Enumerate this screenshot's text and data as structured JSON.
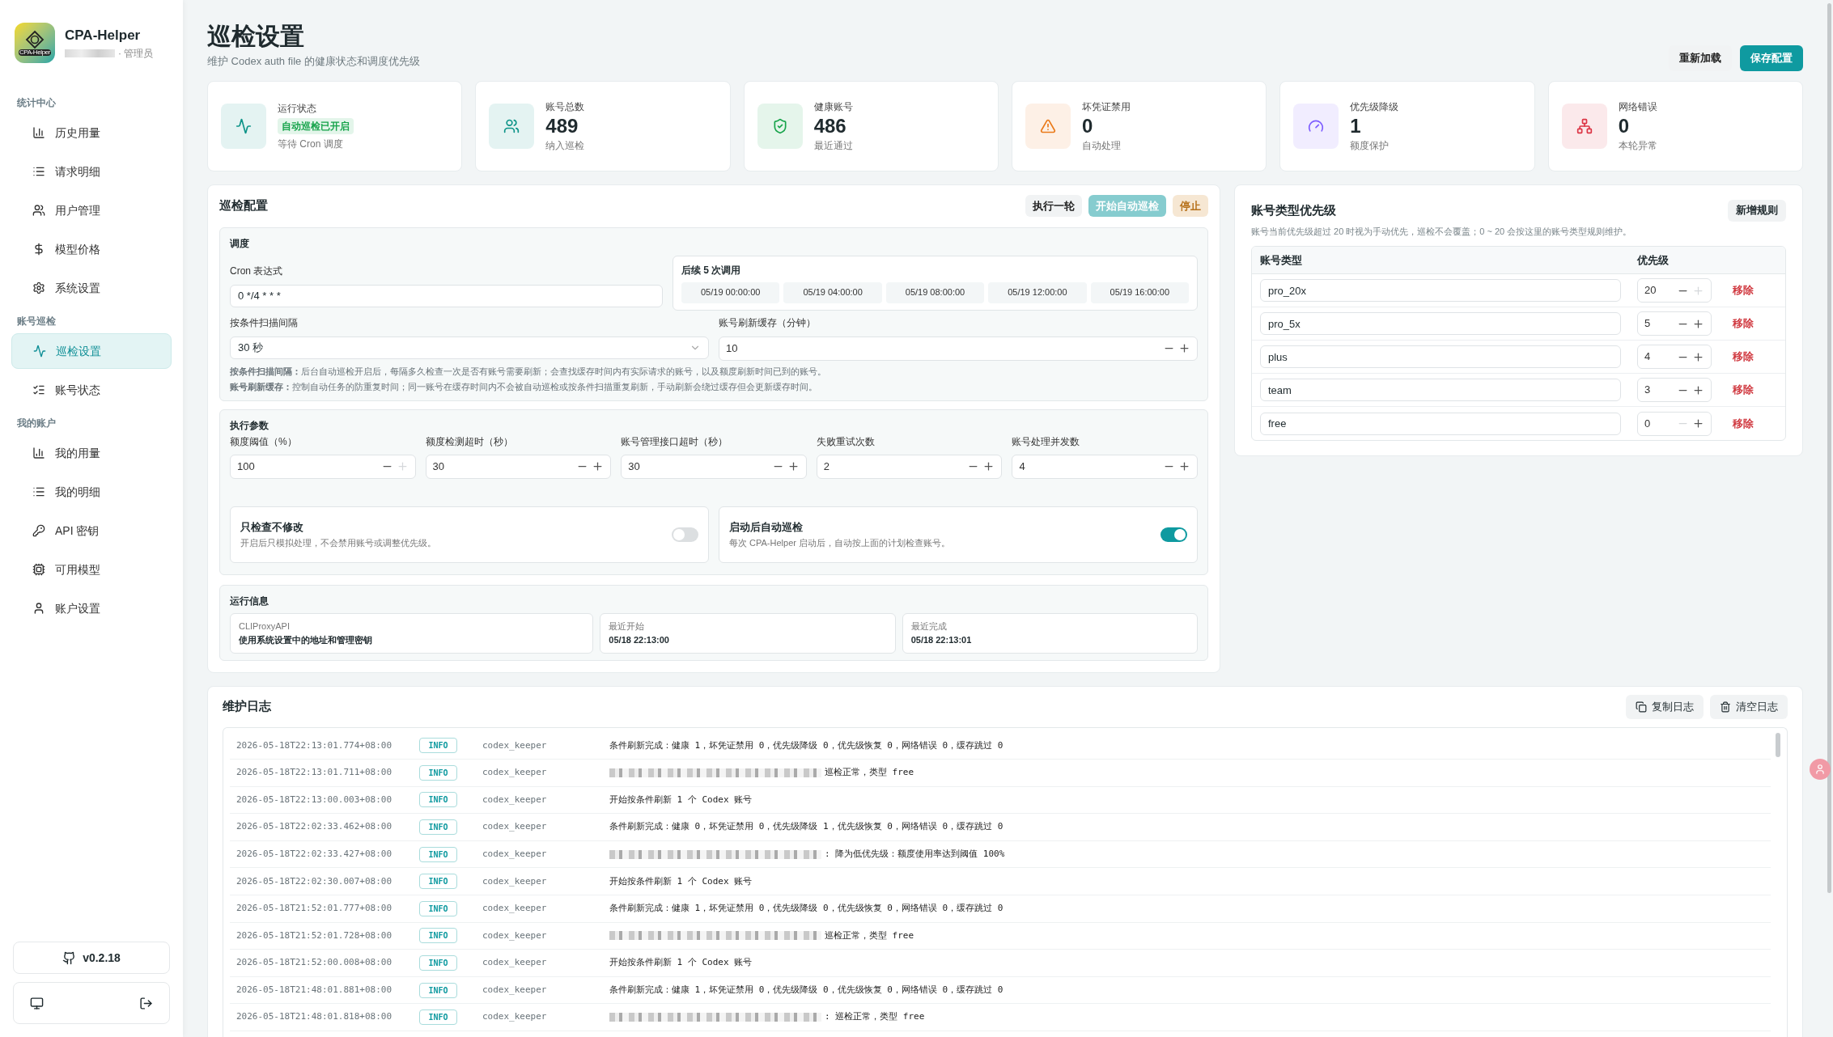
{
  "sidebar": {
    "app_name": "CPA-Helper",
    "logo_text": "CPA-Helper",
    "user_role": "· 管理员",
    "sections": [
      {
        "title": "统计中心",
        "items": [
          {
            "label": "历史用量",
            "selected": false
          },
          {
            "label": "请求明细",
            "selected": false
          },
          {
            "label": "用户管理",
            "selected": false
          },
          {
            "label": "模型价格",
            "selected": false
          },
          {
            "label": "系统设置",
            "selected": false
          }
        ]
      },
      {
        "title": "账号巡检",
        "items": [
          {
            "label": "巡检设置",
            "selected": true
          },
          {
            "label": "账号状态",
            "selected": false
          }
        ]
      },
      {
        "title": "我的账户",
        "items": [
          {
            "label": "我的用量",
            "selected": false
          },
          {
            "label": "我的明细",
            "selected": false
          },
          {
            "label": "API 密钥",
            "selected": false
          },
          {
            "label": "可用模型",
            "selected": false
          },
          {
            "label": "账户设置",
            "selected": false
          }
        ]
      }
    ],
    "version": "v0.2.18"
  },
  "header": {
    "title": "巡检设置",
    "subtitle": "维护 Codex auth file 的健康状态和调度优先级",
    "buttons": [
      {
        "label": "重新加载",
        "kind": "neutral"
      },
      {
        "label": "保存配置",
        "kind": "primary"
      }
    ]
  },
  "stats": [
    {
      "label": "运行状态",
      "badge": "自动巡检已开启",
      "note": "等待 Cron 调度",
      "color": "#0d9488"
    },
    {
      "label": "账号总数",
      "value": "489",
      "note": "纳入巡检",
      "color": "#0d9488"
    },
    {
      "label": "健康账号",
      "value": "486",
      "note": "最近通过",
      "color": "#16a34a"
    },
    {
      "label": "坏凭证禁用",
      "value": "0",
      "note": "自动处理",
      "color": "#ea7a1a"
    },
    {
      "label": "优先级降级",
      "value": "1",
      "note": "额度保护",
      "color": "#7c5cff"
    },
    {
      "label": "网络错误",
      "value": "0",
      "note": "本轮异常",
      "color": "#dc3545"
    }
  ],
  "config": {
    "title": "巡检配置",
    "buttons": [
      {
        "label": "执行一轮",
        "kind": "neutral",
        "disabled": false
      },
      {
        "label": "开始自动巡检",
        "kind": "primary",
        "disabled": true
      },
      {
        "label": "停止",
        "kind": "warning",
        "disabled": false
      }
    ],
    "schedule": {
      "title": "调度",
      "cron_label": "Cron 表达式",
      "cron_value": "0 */4 * * *",
      "next_title": "后续 5 次调用",
      "next_runs": [
        "05/19 00:00:00",
        "05/19 04:00:00",
        "05/19 08:00:00",
        "05/19 12:00:00",
        "05/19 16:00:00"
      ],
      "interval_label": "按条件扫描间隔",
      "interval_value": "30 秒",
      "cache_label": "账号刷新缓存（分钟）",
      "cache_value": "10",
      "notes": [
        "**按条件扫描间隔：**后台自动巡检开启后，每隔多久检查一次是否有账号需要刷新；会查找缓存时间内有实际请求的账号，以及额度刷新时间已到的账号。",
        "**账号刷新缓存：**控制自动任务的防重复时间；同一账号在缓存时间内不会被自动巡检或按条件扫描重复刷新，手动刷新会绕过缓存但会更新缓存时间。"
      ]
    },
    "params": {
      "title": "执行参数",
      "fields": [
        {
          "label": "额度阈值（%）",
          "value": "100",
          "minus_disabled": false,
          "plus_disabled": true
        },
        {
          "label": "额度检测超时（秒）",
          "value": "30",
          "minus_disabled": false,
          "plus_disabled": false
        },
        {
          "label": "账号管理接口超时（秒）",
          "value": "30",
          "minus_disabled": false,
          "plus_disabled": false
        },
        {
          "label": "失败重试次数",
          "value": "2",
          "minus_disabled": false,
          "plus_disabled": false
        },
        {
          "label": "账号处理并发数",
          "value": "4",
          "minus_disabled": false,
          "plus_disabled": false
        }
      ],
      "toggles": [
        {
          "title": "只检查不修改",
          "description": "开启后只模拟处理，不会禁用账号或调整优先级。",
          "on": false
        },
        {
          "title": "启动后自动巡检",
          "description": "每次 CPA-Helper 启动后，自动按上面的计划检查账号。",
          "on": true
        }
      ]
    },
    "runtime": {
      "title": "运行信息",
      "items": [
        {
          "label": "CLIProxyAPI",
          "value": "使用系统设置中的地址和管理密钥"
        },
        {
          "label": "最近开始",
          "value": "05/18 22:13:00"
        },
        {
          "label": "最近完成",
          "value": "05/18 22:13:01"
        }
      ]
    }
  },
  "priority": {
    "title": "账号类型优先级",
    "action": "新增规则",
    "description": "账号当前优先级超过 20 时视为手动优先，巡检不会覆盖；0 ~ 20 会按这里的账号类型规则维护。",
    "columns": [
      "账号类型",
      "优先级"
    ],
    "rows": [
      {
        "type": "pro_20x",
        "priority": "20",
        "minus_disabled": false,
        "plus_disabled": true,
        "remove": "移除"
      },
      {
        "type": "pro_5x",
        "priority": "5",
        "minus_disabled": false,
        "plus_disabled": false,
        "remove": "移除"
      },
      {
        "type": "plus",
        "priority": "4",
        "minus_disabled": false,
        "plus_disabled": false,
        "remove": "移除"
      },
      {
        "type": "team",
        "priority": "3",
        "minus_disabled": false,
        "plus_disabled": false,
        "remove": "移除"
      },
      {
        "type": "free",
        "priority": "0",
        "minus_disabled": true,
        "plus_disabled": false,
        "remove": "移除"
      }
    ]
  },
  "log": {
    "title": "维护日志",
    "buttons": [
      "复制日志",
      "清空日志"
    ],
    "entries": [
      {
        "time": "2026-05-18T22:13:01.774+08:00",
        "level": "INFO",
        "source": "codex_keeper",
        "message": "条件刷新完成：健康 1，坏凭证禁用 0，优先级降级 0，优先级恢复 0，网络错误 0，缓存跳过 0",
        "redacted": false
      },
      {
        "time": "2026-05-18T22:13:01.711+08:00",
        "level": "INFO",
        "source": "codex_keeper",
        "message": "巡检正常，类型 free",
        "redacted": true
      },
      {
        "time": "2026-05-18T22:13:00.003+08:00",
        "level": "INFO",
        "source": "codex_keeper",
        "message": "开始按条件刷新 1 个 Codex 账号",
        "redacted": false
      },
      {
        "time": "2026-05-18T22:02:33.462+08:00",
        "level": "INFO",
        "source": "codex_keeper",
        "message": "条件刷新完成：健康 0，坏凭证禁用 0，优先级降级 1，优先级恢复 0，网络错误 0，缓存跳过 0",
        "redacted": false
      },
      {
        "time": "2026-05-18T22:02:33.427+08:00",
        "level": "INFO",
        "source": "codex_keeper",
        "message": ": 降为低优先级：额度使用率达到阈值 100%",
        "redacted": true
      },
      {
        "time": "2026-05-18T22:02:30.007+08:00",
        "level": "INFO",
        "source": "codex_keeper",
        "message": "开始按条件刷新 1 个 Codex 账号",
        "redacted": false
      },
      {
        "time": "2026-05-18T21:52:01.777+08:00",
        "level": "INFO",
        "source": "codex_keeper",
        "message": "条件刷新完成：健康 1，坏凭证禁用 0，优先级降级 0，优先级恢复 0，网络错误 0，缓存跳过 0",
        "redacted": false
      },
      {
        "time": "2026-05-18T21:52:01.728+08:00",
        "level": "INFO",
        "source": "codex_keeper",
        "message": "巡检正常，类型 free",
        "redacted": true
      },
      {
        "time": "2026-05-18T21:52:00.008+08:00",
        "level": "INFO",
        "source": "codex_keeper",
        "message": "开始按条件刷新 1 个 Codex 账号",
        "redacted": false
      },
      {
        "time": "2026-05-18T21:48:01.881+08:00",
        "level": "INFO",
        "source": "codex_keeper",
        "message": "条件刷新完成：健康 1，坏凭证禁用 0，优先级降级 0，优先级恢复 0，网络错误 0，缓存跳过 0",
        "redacted": false
      },
      {
        "time": "2026-05-18T21:48:01.818+08:00",
        "level": "INFO",
        "source": "codex_keeper",
        "message": ": 巡检正常，类型 free",
        "redacted": true
      }
    ]
  }
}
